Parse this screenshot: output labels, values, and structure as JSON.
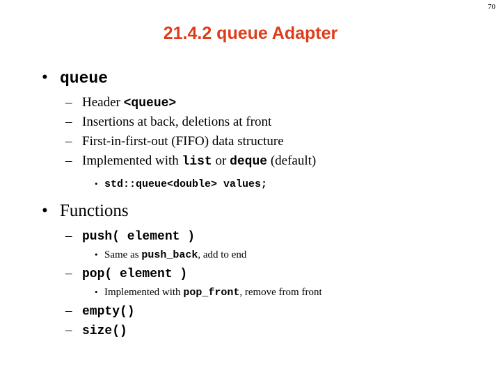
{
  "page": {
    "number": "70",
    "title": "21.4.2 queue Adapter",
    "title_color": "#dd3d1a",
    "background_color": "#ffffff",
    "text_color": "#000000"
  },
  "markers": {
    "level1": "•",
    "level2": "–",
    "level3": "•"
  },
  "outline": {
    "queue_heading": "queue",
    "header_label": "Header ",
    "header_code": "<queue>",
    "insertions": "Insertions at back, deletions at front",
    "fifo": "First-in-first-out (FIFO) data structure",
    "implemented_with_pre": "Implemented with ",
    "implemented_with_list": "list",
    "implemented_with_mid": " or ",
    "implemented_with_deque": "deque",
    "implemented_with_post": " (default)",
    "declaration": "std::queue<double> values;",
    "functions_heading": "Functions",
    "push_signature": "push( element )",
    "push_note_pre": "Same as ",
    "push_note_code": "push_back",
    "push_note_post": ", add to end",
    "pop_signature": "pop( element )",
    "pop_note_pre": "Implemented with ",
    "pop_note_code": "pop_front",
    "pop_note_post": ", remove from front",
    "empty_signature": "empty()",
    "size_signature": "size()"
  }
}
